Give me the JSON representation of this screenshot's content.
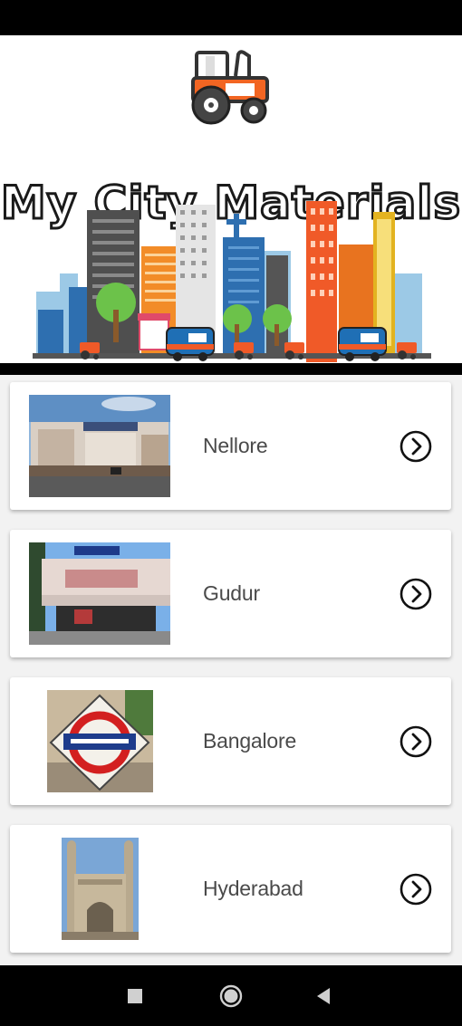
{
  "app": {
    "title": "My City Materials"
  },
  "cities": [
    {
      "name": "Nellore",
      "image": "nellore-station-photo"
    },
    {
      "name": "Gudur",
      "image": "gudur-station-photo"
    },
    {
      "name": "Bangalore",
      "image": "bengaluru-east-sign-photo"
    },
    {
      "name": "Hyderabad",
      "image": "charminar-photo"
    }
  ],
  "icons": {
    "chevron": "chevron-right-circle-icon",
    "nav_recents": "square-icon",
    "nav_home": "circle-icon",
    "nav_back": "triangle-back-icon"
  },
  "colors": {
    "accent_orange": "#f26522",
    "bar_black": "#000000",
    "card_bg": "#ffffff",
    "page_bg": "#f2f2f2",
    "text": "#4a4a4a"
  }
}
